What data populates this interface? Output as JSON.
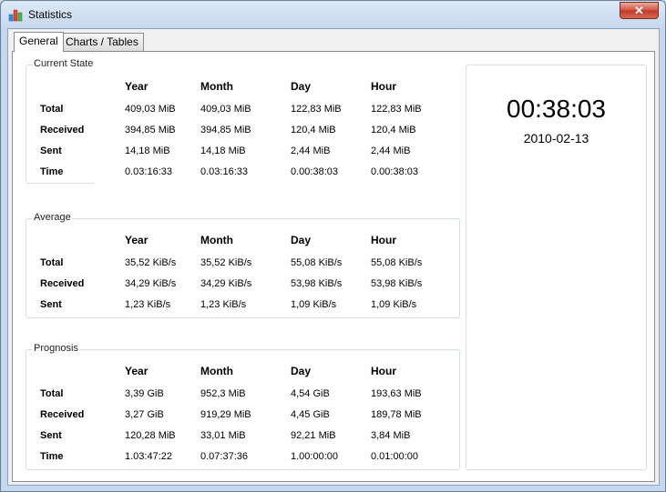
{
  "window": {
    "title": "Statistics",
    "close_glyph": "✕"
  },
  "tabs": [
    "General",
    "Charts / Tables"
  ],
  "columns": [
    "Year",
    "Month",
    "Day",
    "Hour"
  ],
  "current_state": {
    "title": "Current State",
    "rows": [
      {
        "label": "Total",
        "values": [
          "409,03 MiB",
          "409,03 MiB",
          "122,83 MiB",
          "122,83 MiB"
        ]
      },
      {
        "label": "Received",
        "values": [
          "394,85 MiB",
          "394,85 MiB",
          "120,4 MiB",
          "120,4 MiB"
        ]
      },
      {
        "label": "Sent",
        "values": [
          "14,18 MiB",
          "14,18 MiB",
          "2,44 MiB",
          "2,44 MiB"
        ]
      },
      {
        "label": "Time",
        "values": [
          "0.03:16:33",
          "0.03:16:33",
          "0.00:38:03",
          "0.00:38:03"
        ]
      }
    ]
  },
  "average": {
    "title": "Average",
    "rows": [
      {
        "label": "Total",
        "values": [
          "35,52 KiB/s",
          "35,52 KiB/s",
          "55,08 KiB/s",
          "55,08 KiB/s"
        ]
      },
      {
        "label": "Received",
        "values": [
          "34,29 KiB/s",
          "34,29 KiB/s",
          "53,98 KiB/s",
          "53,98 KiB/s"
        ]
      },
      {
        "label": "Sent",
        "values": [
          "1,23 KiB/s",
          "1,23 KiB/s",
          "1,09 KiB/s",
          "1,09 KiB/s"
        ]
      }
    ]
  },
  "prognosis": {
    "title": "Prognosis",
    "rows": [
      {
        "label": "Total",
        "values": [
          "3,39 GiB",
          "952,3 MiB",
          "4,54 GiB",
          "193,63 MiB"
        ]
      },
      {
        "label": "Received",
        "values": [
          "3,27 GiB",
          "919,29 MiB",
          "4,45 GiB",
          "189,78 MiB"
        ]
      },
      {
        "label": "Sent",
        "values": [
          "120,28 MiB",
          "33,01 MiB",
          "92,21 MiB",
          "3,84 MiB"
        ]
      },
      {
        "label": "Time",
        "values": [
          "1.03:47:22",
          "0.07:37:36",
          "1.00:00:00",
          "0.01:00:00"
        ]
      }
    ]
  },
  "clock": {
    "time": "00:38:03",
    "date": "2010-02-13"
  }
}
